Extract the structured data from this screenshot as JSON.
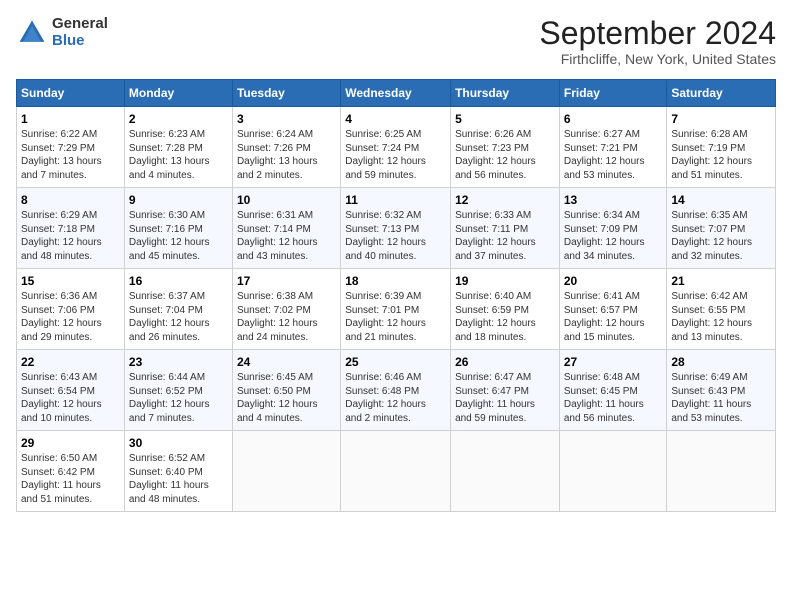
{
  "header": {
    "logo_general": "General",
    "logo_blue": "Blue",
    "title": "September 2024",
    "location": "Firthcliffe, New York, United States"
  },
  "calendar": {
    "headers": [
      "Sunday",
      "Monday",
      "Tuesday",
      "Wednesday",
      "Thursday",
      "Friday",
      "Saturday"
    ],
    "weeks": [
      [
        {
          "day": "1",
          "info": "Sunrise: 6:22 AM\nSunset: 7:29 PM\nDaylight: 13 hours\nand 7 minutes."
        },
        {
          "day": "2",
          "info": "Sunrise: 6:23 AM\nSunset: 7:28 PM\nDaylight: 13 hours\nand 4 minutes."
        },
        {
          "day": "3",
          "info": "Sunrise: 6:24 AM\nSunset: 7:26 PM\nDaylight: 13 hours\nand 2 minutes."
        },
        {
          "day": "4",
          "info": "Sunrise: 6:25 AM\nSunset: 7:24 PM\nDaylight: 12 hours\nand 59 minutes."
        },
        {
          "day": "5",
          "info": "Sunrise: 6:26 AM\nSunset: 7:23 PM\nDaylight: 12 hours\nand 56 minutes."
        },
        {
          "day": "6",
          "info": "Sunrise: 6:27 AM\nSunset: 7:21 PM\nDaylight: 12 hours\nand 53 minutes."
        },
        {
          "day": "7",
          "info": "Sunrise: 6:28 AM\nSunset: 7:19 PM\nDaylight: 12 hours\nand 51 minutes."
        }
      ],
      [
        {
          "day": "8",
          "info": "Sunrise: 6:29 AM\nSunset: 7:18 PM\nDaylight: 12 hours\nand 48 minutes."
        },
        {
          "day": "9",
          "info": "Sunrise: 6:30 AM\nSunset: 7:16 PM\nDaylight: 12 hours\nand 45 minutes."
        },
        {
          "day": "10",
          "info": "Sunrise: 6:31 AM\nSunset: 7:14 PM\nDaylight: 12 hours\nand 43 minutes."
        },
        {
          "day": "11",
          "info": "Sunrise: 6:32 AM\nSunset: 7:13 PM\nDaylight: 12 hours\nand 40 minutes."
        },
        {
          "day": "12",
          "info": "Sunrise: 6:33 AM\nSunset: 7:11 PM\nDaylight: 12 hours\nand 37 minutes."
        },
        {
          "day": "13",
          "info": "Sunrise: 6:34 AM\nSunset: 7:09 PM\nDaylight: 12 hours\nand 34 minutes."
        },
        {
          "day": "14",
          "info": "Sunrise: 6:35 AM\nSunset: 7:07 PM\nDaylight: 12 hours\nand 32 minutes."
        }
      ],
      [
        {
          "day": "15",
          "info": "Sunrise: 6:36 AM\nSunset: 7:06 PM\nDaylight: 12 hours\nand 29 minutes."
        },
        {
          "day": "16",
          "info": "Sunrise: 6:37 AM\nSunset: 7:04 PM\nDaylight: 12 hours\nand 26 minutes."
        },
        {
          "day": "17",
          "info": "Sunrise: 6:38 AM\nSunset: 7:02 PM\nDaylight: 12 hours\nand 24 minutes."
        },
        {
          "day": "18",
          "info": "Sunrise: 6:39 AM\nSunset: 7:01 PM\nDaylight: 12 hours\nand 21 minutes."
        },
        {
          "day": "19",
          "info": "Sunrise: 6:40 AM\nSunset: 6:59 PM\nDaylight: 12 hours\nand 18 minutes."
        },
        {
          "day": "20",
          "info": "Sunrise: 6:41 AM\nSunset: 6:57 PM\nDaylight: 12 hours\nand 15 minutes."
        },
        {
          "day": "21",
          "info": "Sunrise: 6:42 AM\nSunset: 6:55 PM\nDaylight: 12 hours\nand 13 minutes."
        }
      ],
      [
        {
          "day": "22",
          "info": "Sunrise: 6:43 AM\nSunset: 6:54 PM\nDaylight: 12 hours\nand 10 minutes."
        },
        {
          "day": "23",
          "info": "Sunrise: 6:44 AM\nSunset: 6:52 PM\nDaylight: 12 hours\nand 7 minutes."
        },
        {
          "day": "24",
          "info": "Sunrise: 6:45 AM\nSunset: 6:50 PM\nDaylight: 12 hours\nand 4 minutes."
        },
        {
          "day": "25",
          "info": "Sunrise: 6:46 AM\nSunset: 6:48 PM\nDaylight: 12 hours\nand 2 minutes."
        },
        {
          "day": "26",
          "info": "Sunrise: 6:47 AM\nSunset: 6:47 PM\nDaylight: 11 hours\nand 59 minutes."
        },
        {
          "day": "27",
          "info": "Sunrise: 6:48 AM\nSunset: 6:45 PM\nDaylight: 11 hours\nand 56 minutes."
        },
        {
          "day": "28",
          "info": "Sunrise: 6:49 AM\nSunset: 6:43 PM\nDaylight: 11 hours\nand 53 minutes."
        }
      ],
      [
        {
          "day": "29",
          "info": "Sunrise: 6:50 AM\nSunset: 6:42 PM\nDaylight: 11 hours\nand 51 minutes."
        },
        {
          "day": "30",
          "info": "Sunrise: 6:52 AM\nSunset: 6:40 PM\nDaylight: 11 hours\nand 48 minutes."
        },
        {
          "day": "",
          "info": ""
        },
        {
          "day": "",
          "info": ""
        },
        {
          "day": "",
          "info": ""
        },
        {
          "day": "",
          "info": ""
        },
        {
          "day": "",
          "info": ""
        }
      ]
    ]
  }
}
